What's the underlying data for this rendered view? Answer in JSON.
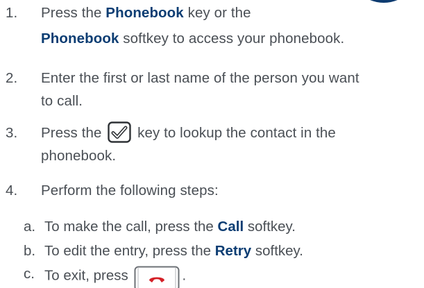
{
  "steps": [
    {
      "num": "1.",
      "line1_pre": "Press the ",
      "line1_kw": "Phonebook",
      "line1_post": " key or the",
      "line2_kw": "Phonebook",
      "line2_post": " softkey to access your phonebook."
    },
    {
      "num": "2.",
      "line1": "Enter the first or last name of the person you want",
      "line2": "to call."
    },
    {
      "num": "3.",
      "line1_pre": "Press the ",
      "line1_post": " key to lookup the contact in the",
      "line2": "phonebook.",
      "icon": "checkmark-key-icon"
    },
    {
      "num": "4.",
      "line1": "Perform the following steps:"
    }
  ],
  "substeps": [
    {
      "num": "a.",
      "pre": "To make the call, press the ",
      "kw": "Call",
      "post": " softkey."
    },
    {
      "num": "b.",
      "pre": "To edit the entry, press the ",
      "kw": "Retry",
      "post": " softkey."
    },
    {
      "num": "c.",
      "pre": "To exit, press ",
      "post": ".",
      "icon": "end-call-key-icon"
    }
  ],
  "colors": {
    "body_text": "#4a4f55",
    "keyword": "#0c3d73",
    "corner_graphic": "#0d3b70",
    "end_call_red": "#d42027"
  }
}
